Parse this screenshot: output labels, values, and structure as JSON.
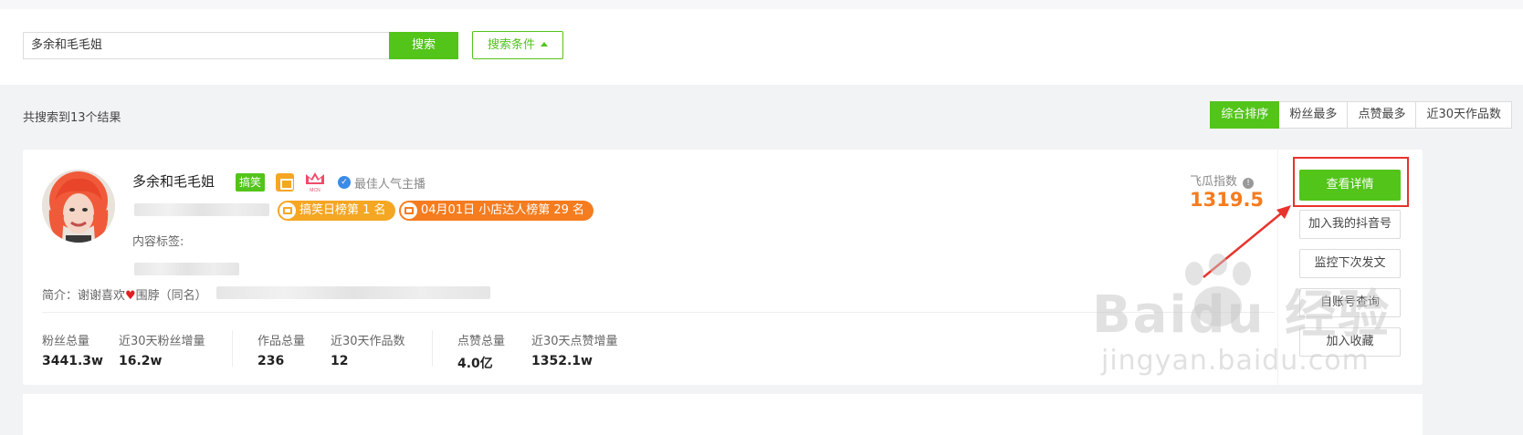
{
  "search": {
    "value": "多余和毛毛姐",
    "button_label": "搜索",
    "conditions_label": "搜索条件"
  },
  "results": {
    "count_text": "共搜索到13个结果"
  },
  "sort_tabs": [
    {
      "label": "综合排序",
      "active": true
    },
    {
      "label": "粉丝最多",
      "active": false
    },
    {
      "label": "点赞最多",
      "active": false
    },
    {
      "label": "近30天作品数",
      "active": false
    }
  ],
  "card": {
    "name": "多余和毛毛姐",
    "category_tag": "搞笑",
    "mcn_label": "MCN",
    "verified_label": "最佳人气主播",
    "rank_badges": [
      {
        "text": "搞笑日榜第 1 名"
      },
      {
        "text": "04月01日 小店达人榜第 29 名"
      }
    ],
    "content_tags_label": "内容标签:",
    "intro_prefix": "简介：谢谢喜欢",
    "intro_suffix": "围脖（同名）",
    "stats": [
      {
        "label": "粉丝总量",
        "value": "3441.3w"
      },
      {
        "label": "近30天粉丝增量",
        "value": "16.2w"
      },
      {
        "label": "作品总量",
        "value": "236"
      },
      {
        "label": "近30天作品数",
        "value": "12"
      },
      {
        "label": "点赞总量",
        "value": "4.0亿"
      },
      {
        "label": "近30天点赞增量",
        "value": "1352.1w"
      }
    ],
    "index_label": "飞瓜指数",
    "index_value": "1319.5",
    "actions": {
      "detail": "查看详情",
      "add_account": "加入我的抖音号",
      "monitor": "监控下次发文",
      "account_query": "自账号查询",
      "favorite": "加入收藏"
    }
  },
  "watermark": {
    "main": "Baidu 经验",
    "sub": "jingyan.baidu.com"
  },
  "colors": {
    "accent": "#52c41a",
    "orange": "#f57c1f",
    "highlight": "#e8332d"
  }
}
